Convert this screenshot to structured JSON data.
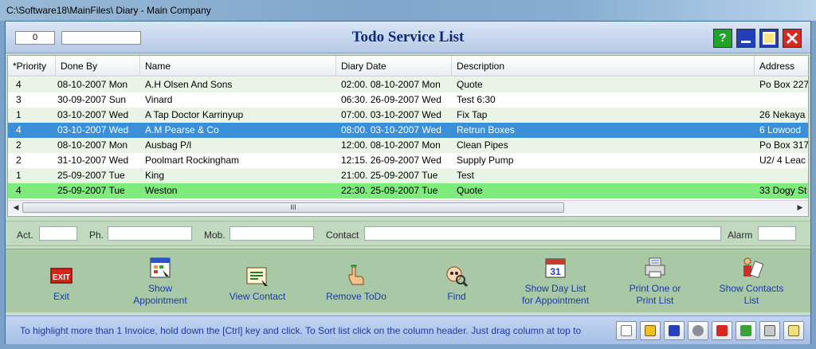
{
  "window": {
    "title": "C:\\Software18\\MainFiles\\ Diary - Main Company"
  },
  "header": {
    "counter": "0",
    "title": "Todo Service List"
  },
  "columns": [
    "*Priority",
    "Done By",
    "Name",
    "Diary Date",
    "Description",
    "Address"
  ],
  "rows": [
    {
      "priority": "4",
      "done_by": "08-10-2007 Mon",
      "name": "A.H Olsen And Sons",
      "diary_date": "02:00. 08-10-2007 Mon",
      "description": "Quote",
      "address": "Po Box 227"
    },
    {
      "priority": "3",
      "done_by": "30-09-2007 Sun",
      "name": "Vinard",
      "diary_date": "06:30. 26-09-2007 Wed",
      "description": "Test 6:30",
      "address": ""
    },
    {
      "priority": "1",
      "done_by": "03-10-2007 Wed",
      "name": "A Tap  Doctor Karrinyup",
      "diary_date": "07:00. 03-10-2007 Wed",
      "description": "Fix Tap",
      "address": "26 Nekaya"
    },
    {
      "priority": "4",
      "done_by": "03-10-2007 Wed",
      "name": "A.M Pearse & Co",
      "diary_date": "08:00. 03-10-2007 Wed",
      "description": "Retrun Boxes",
      "address": "6 Lowood"
    },
    {
      "priority": "2",
      "done_by": "08-10-2007 Mon",
      "name": "Ausbag  P/l",
      "diary_date": "12:00. 08-10-2007 Mon",
      "description": "Clean Pipes",
      "address": "Po Box 317"
    },
    {
      "priority": "2",
      "done_by": "31-10-2007 Wed",
      "name": "Poolmart Rockingham",
      "diary_date": "12:15. 26-09-2007 Wed",
      "description": "Supply Pump",
      "address": "U2/ 4 Leac"
    },
    {
      "priority": "1",
      "done_by": "25-09-2007 Tue",
      "name": "King",
      "diary_date": "21:00. 25-09-2007 Tue",
      "description": "Test",
      "address": ""
    },
    {
      "priority": "4",
      "done_by": "25-09-2007 Tue",
      "name": "Weston",
      "diary_date": "22:30. 25-09-2007 Tue",
      "description": "Quote",
      "address": "33 Dogy St"
    }
  ],
  "scrollbar": {
    "grip": "III"
  },
  "contact": {
    "act_label": "Act.",
    "ph_label": "Ph.",
    "mob_label": "Mob.",
    "contact_label": "Contact",
    "alarm_label": "Alarm"
  },
  "toolbar": {
    "exit": "Exit",
    "show_appointment_1": "Show",
    "show_appointment_2": "Appointment",
    "view_contact": "View Contact",
    "remove_todo": "Remove ToDo",
    "find": "Find",
    "show_day_list_1": "Show Day List",
    "show_day_list_2": "for Appointment",
    "print_1": "Print One or",
    "print_2": "Print List",
    "show_contacts_1": "Show Contacts",
    "show_contacts_2": "List"
  },
  "status": {
    "hint": "To highlight more than 1 Invoice, hold down the [Ctrl] key and click.   To Sort list click on the column header.   Just drag column at top to"
  },
  "colors": {
    "selected_row": "#3a8fd8",
    "green_row": "#7fea7e",
    "title_text": "#0c2a7a",
    "link_text": "#1b3aa8"
  }
}
